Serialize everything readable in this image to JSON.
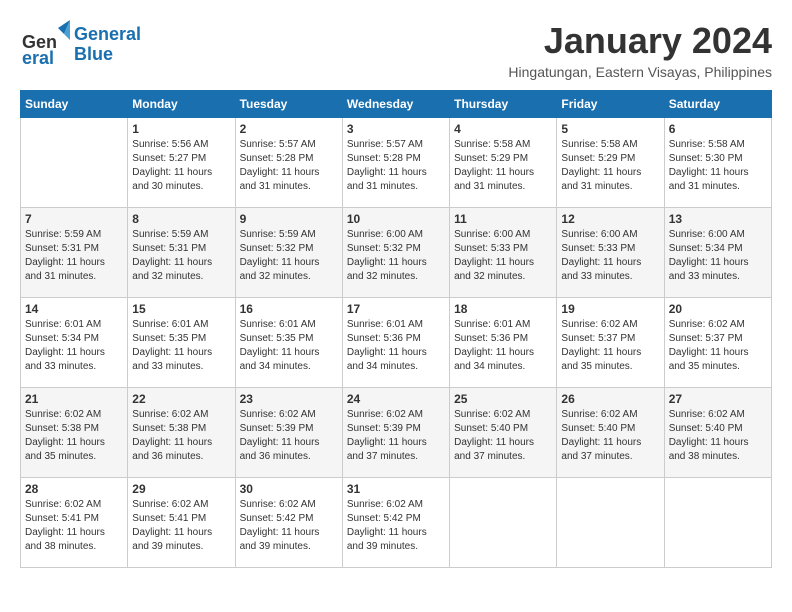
{
  "header": {
    "logo_line1": "General",
    "logo_line2": "Blue",
    "month_year": "January 2024",
    "location": "Hingatungan, Eastern Visayas, Philippines"
  },
  "days_of_week": [
    "Sunday",
    "Monday",
    "Tuesday",
    "Wednesday",
    "Thursday",
    "Friday",
    "Saturday"
  ],
  "weeks": [
    [
      {
        "day": "",
        "info": ""
      },
      {
        "day": "1",
        "info": "Sunrise: 5:56 AM\nSunset: 5:27 PM\nDaylight: 11 hours\nand 30 minutes."
      },
      {
        "day": "2",
        "info": "Sunrise: 5:57 AM\nSunset: 5:28 PM\nDaylight: 11 hours\nand 31 minutes."
      },
      {
        "day": "3",
        "info": "Sunrise: 5:57 AM\nSunset: 5:28 PM\nDaylight: 11 hours\nand 31 minutes."
      },
      {
        "day": "4",
        "info": "Sunrise: 5:58 AM\nSunset: 5:29 PM\nDaylight: 11 hours\nand 31 minutes."
      },
      {
        "day": "5",
        "info": "Sunrise: 5:58 AM\nSunset: 5:29 PM\nDaylight: 11 hours\nand 31 minutes."
      },
      {
        "day": "6",
        "info": "Sunrise: 5:58 AM\nSunset: 5:30 PM\nDaylight: 11 hours\nand 31 minutes."
      }
    ],
    [
      {
        "day": "7",
        "info": "Sunrise: 5:59 AM\nSunset: 5:31 PM\nDaylight: 11 hours\nand 31 minutes."
      },
      {
        "day": "8",
        "info": "Sunrise: 5:59 AM\nSunset: 5:31 PM\nDaylight: 11 hours\nand 32 minutes."
      },
      {
        "day": "9",
        "info": "Sunrise: 5:59 AM\nSunset: 5:32 PM\nDaylight: 11 hours\nand 32 minutes."
      },
      {
        "day": "10",
        "info": "Sunrise: 6:00 AM\nSunset: 5:32 PM\nDaylight: 11 hours\nand 32 minutes."
      },
      {
        "day": "11",
        "info": "Sunrise: 6:00 AM\nSunset: 5:33 PM\nDaylight: 11 hours\nand 32 minutes."
      },
      {
        "day": "12",
        "info": "Sunrise: 6:00 AM\nSunset: 5:33 PM\nDaylight: 11 hours\nand 33 minutes."
      },
      {
        "day": "13",
        "info": "Sunrise: 6:00 AM\nSunset: 5:34 PM\nDaylight: 11 hours\nand 33 minutes."
      }
    ],
    [
      {
        "day": "14",
        "info": "Sunrise: 6:01 AM\nSunset: 5:34 PM\nDaylight: 11 hours\nand 33 minutes."
      },
      {
        "day": "15",
        "info": "Sunrise: 6:01 AM\nSunset: 5:35 PM\nDaylight: 11 hours\nand 33 minutes."
      },
      {
        "day": "16",
        "info": "Sunrise: 6:01 AM\nSunset: 5:35 PM\nDaylight: 11 hours\nand 34 minutes."
      },
      {
        "day": "17",
        "info": "Sunrise: 6:01 AM\nSunset: 5:36 PM\nDaylight: 11 hours\nand 34 minutes."
      },
      {
        "day": "18",
        "info": "Sunrise: 6:01 AM\nSunset: 5:36 PM\nDaylight: 11 hours\nand 34 minutes."
      },
      {
        "day": "19",
        "info": "Sunrise: 6:02 AM\nSunset: 5:37 PM\nDaylight: 11 hours\nand 35 minutes."
      },
      {
        "day": "20",
        "info": "Sunrise: 6:02 AM\nSunset: 5:37 PM\nDaylight: 11 hours\nand 35 minutes."
      }
    ],
    [
      {
        "day": "21",
        "info": "Sunrise: 6:02 AM\nSunset: 5:38 PM\nDaylight: 11 hours\nand 35 minutes."
      },
      {
        "day": "22",
        "info": "Sunrise: 6:02 AM\nSunset: 5:38 PM\nDaylight: 11 hours\nand 36 minutes."
      },
      {
        "day": "23",
        "info": "Sunrise: 6:02 AM\nSunset: 5:39 PM\nDaylight: 11 hours\nand 36 minutes."
      },
      {
        "day": "24",
        "info": "Sunrise: 6:02 AM\nSunset: 5:39 PM\nDaylight: 11 hours\nand 37 minutes."
      },
      {
        "day": "25",
        "info": "Sunrise: 6:02 AM\nSunset: 5:40 PM\nDaylight: 11 hours\nand 37 minutes."
      },
      {
        "day": "26",
        "info": "Sunrise: 6:02 AM\nSunset: 5:40 PM\nDaylight: 11 hours\nand 37 minutes."
      },
      {
        "day": "27",
        "info": "Sunrise: 6:02 AM\nSunset: 5:40 PM\nDaylight: 11 hours\nand 38 minutes."
      }
    ],
    [
      {
        "day": "28",
        "info": "Sunrise: 6:02 AM\nSunset: 5:41 PM\nDaylight: 11 hours\nand 38 minutes."
      },
      {
        "day": "29",
        "info": "Sunrise: 6:02 AM\nSunset: 5:41 PM\nDaylight: 11 hours\nand 39 minutes."
      },
      {
        "day": "30",
        "info": "Sunrise: 6:02 AM\nSunset: 5:42 PM\nDaylight: 11 hours\nand 39 minutes."
      },
      {
        "day": "31",
        "info": "Sunrise: 6:02 AM\nSunset: 5:42 PM\nDaylight: 11 hours\nand 39 minutes."
      },
      {
        "day": "",
        "info": ""
      },
      {
        "day": "",
        "info": ""
      },
      {
        "day": "",
        "info": ""
      }
    ]
  ]
}
